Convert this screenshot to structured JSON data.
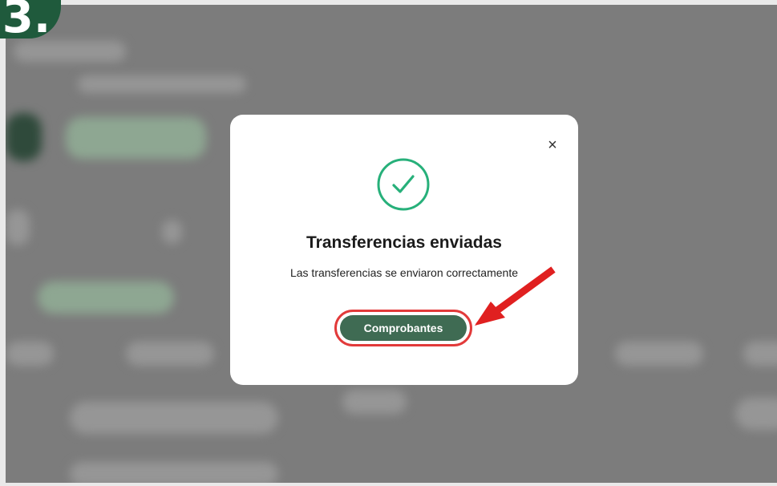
{
  "step_label": "3.",
  "modal": {
    "close_icon": "×",
    "title": "Transferencias enviadas",
    "message": "Las transferencias se enviaron correctamente",
    "button_label": "Comprobantes"
  },
  "colors": {
    "accent": "#3f6b53",
    "success": "#27b07a",
    "highlight": "#e23a3a",
    "badge": "#1f5a3c"
  },
  "icons": {
    "success": "check-circle-icon",
    "close": "close-icon",
    "pointer": "red-arrow-annotation"
  }
}
